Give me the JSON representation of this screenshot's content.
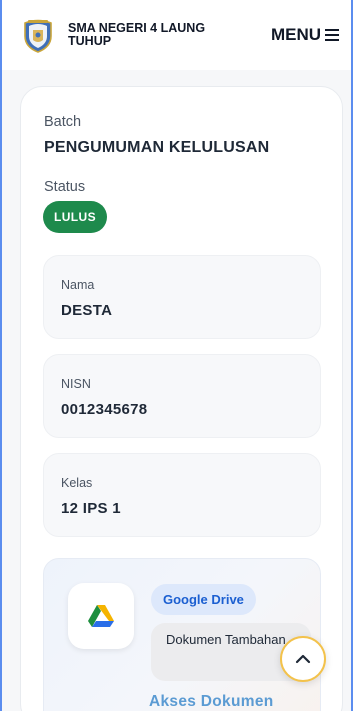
{
  "header": {
    "school_name": "SMA NEGERI 4 LAUNG TUHUP",
    "menu_label": "MENU",
    "logo_icon": "school-crest-icon",
    "burger_icon": "hamburger-icon"
  },
  "result": {
    "batch_label": "Batch",
    "batch_value": "PENGUMUMAN KELULUSAN",
    "status_label": "Status",
    "status_value": "LULUS",
    "status_color": "#1e8a4c"
  },
  "fields": [
    {
      "label": "Nama",
      "value": "DESTA"
    },
    {
      "label": "NISN",
      "value": "0012345678"
    },
    {
      "label": "Kelas",
      "value": "12 IPS 1"
    }
  ],
  "document": {
    "source_chip": "Google Drive",
    "description": "Dokumen Tambahan",
    "access_link": "Akses Dokumen",
    "icon": "google-drive-icon"
  },
  "scroll_top_icon": "chevron-up-icon"
}
